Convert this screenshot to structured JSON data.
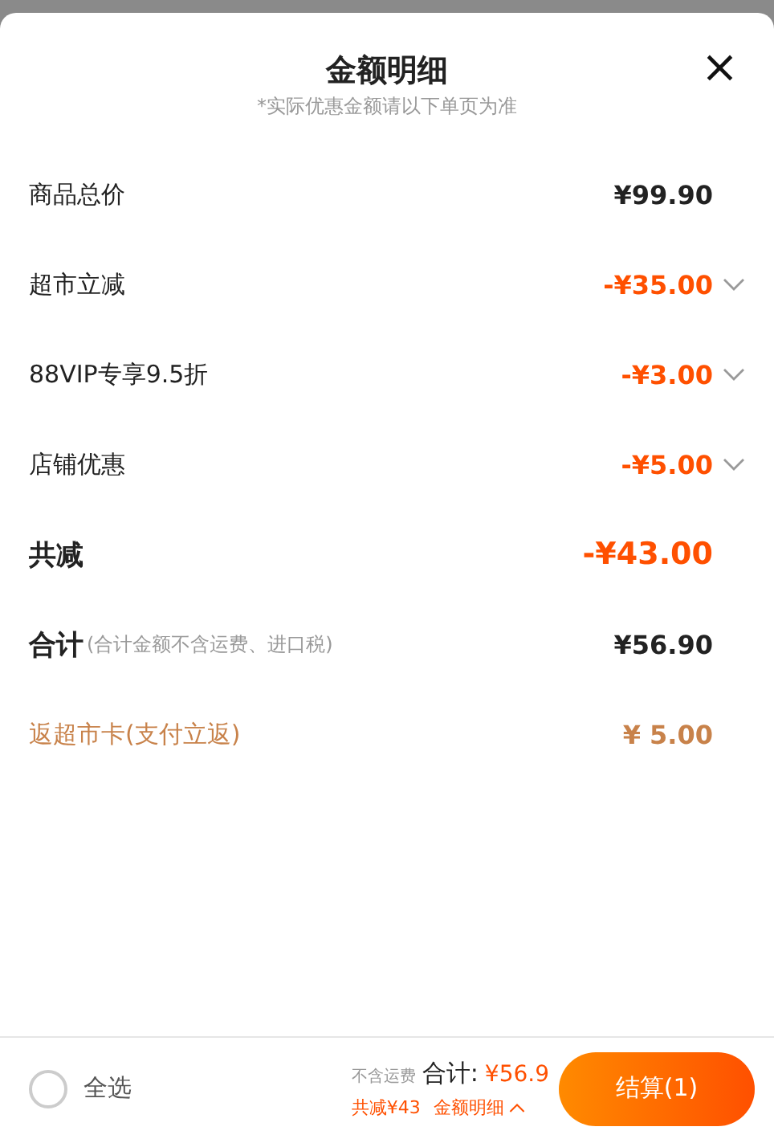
{
  "sheet": {
    "title": "金额明细",
    "subtitle": "*实际优惠金额请以下单页为准",
    "close": "×"
  },
  "rows": [
    {
      "kind": "plain",
      "label": "商品总价",
      "amount": "¥99.90"
    },
    {
      "kind": "discount",
      "label": "超市立减",
      "amount": "-¥35.00",
      "expanded": false
    },
    {
      "kind": "discount",
      "label": "88VIP专享9.5折",
      "amount": "-¥3.00",
      "expanded": false
    },
    {
      "kind": "discount",
      "label": "店铺优惠",
      "amount": "-¥5.00",
      "expanded": false
    },
    {
      "kind": "reduce",
      "label": "共减",
      "amount": "-¥43.00"
    },
    {
      "kind": "sum",
      "label": "合计",
      "note": "(合计金额不含运费、进口税)",
      "amount": "¥56.90"
    },
    {
      "kind": "rebate",
      "label": "返超市卡(支付立返)",
      "amount": "¥ 5.00"
    }
  ],
  "bottom_bar": {
    "select_all": {
      "label": "全选",
      "checked": false
    },
    "shipping_note": "不含运费",
    "total_label": "合计:",
    "total": "¥56.9",
    "reduced": "共减¥43",
    "details": "金额明细",
    "details_expanded": true,
    "checkout": "结算(1)"
  }
}
